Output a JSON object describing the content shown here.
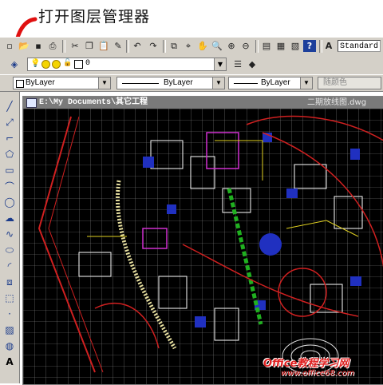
{
  "caption": "打开图层管理器",
  "toolbar": {
    "text_style": "Standard"
  },
  "layer_bar": {
    "current_layer": "0"
  },
  "properties_bar": {
    "color": "ByLayer",
    "linetype": "ByLayer",
    "lineweight": "ByLayer",
    "plot_style": "随颜色"
  },
  "drawing_window": {
    "path_title": "E:\\My Documents\\其它工程",
    "file_name": "二期放线图.dwg"
  },
  "watermark": {
    "line1": "Office教程学习网",
    "line2": "www.office68.com"
  },
  "colors": {
    "toolbar_bg": "#d4d0c8",
    "canvas_bg": "#000000",
    "arrow": "#e01010",
    "grid": "#8a8a8a"
  }
}
